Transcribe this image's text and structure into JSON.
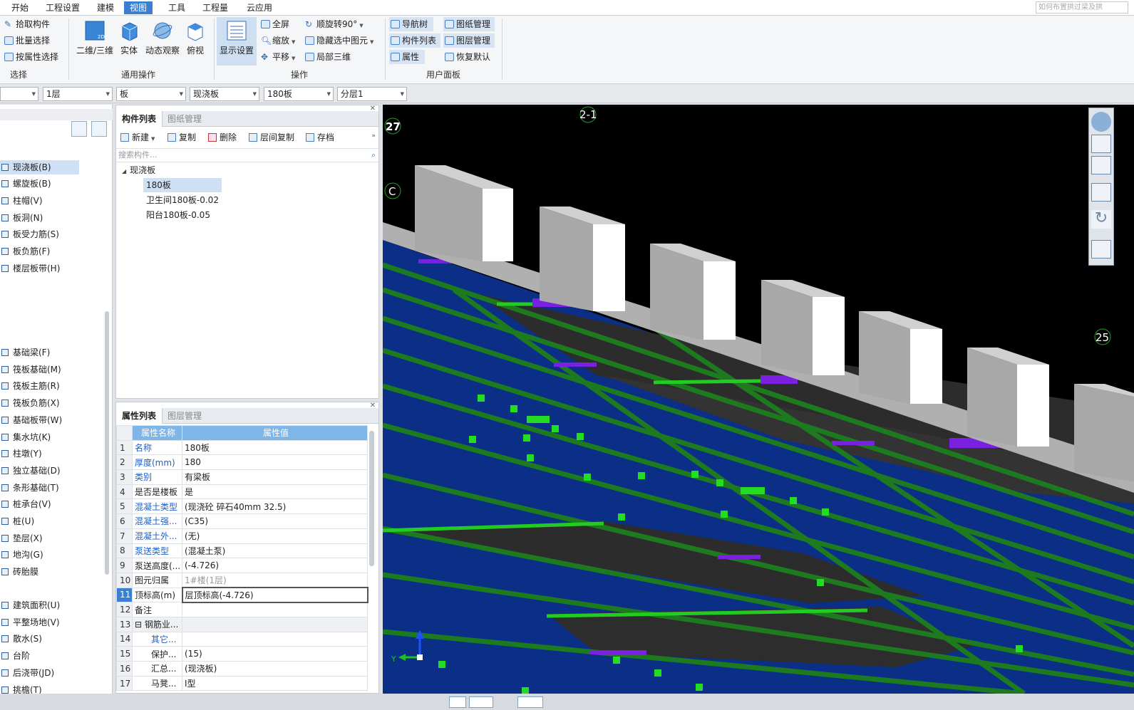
{
  "menubar": {
    "items": [
      "开始",
      "工程设置",
      "建模",
      "视图",
      "工具",
      "工程量",
      "云应用"
    ],
    "active": "视图",
    "search_placeholder": "如何布置拱过梁及拱"
  },
  "ribbon": {
    "select_group": {
      "items": [
        "拾取构件",
        "批量选择",
        "按属性选择"
      ],
      "label": "选择"
    },
    "common_group": {
      "items": [
        "二维/三维",
        "实体",
        "动态观察",
        "俯视"
      ],
      "label": "通用操作"
    },
    "ops_group": {
      "display_settings": "显示设置",
      "col1": [
        "全屏",
        "缩放",
        "平移"
      ],
      "col2": [
        "顺旋转90°",
        "隐藏选中图元",
        "局部三维"
      ],
      "label": "操作"
    },
    "user_group": {
      "col1": [
        "导航树",
        "构件列表",
        "属性"
      ],
      "col2": [
        "图纸管理",
        "图层管理",
        "恢复默认"
      ],
      "label": "用户面板"
    }
  },
  "combos": [
    "",
    "1层",
    "板",
    "现浇板",
    "180板",
    "分层1"
  ],
  "nav": {
    "items": [
      {
        "label": "现浇板(B)",
        "selected": true
      },
      {
        "label": "螺旋板(B)"
      },
      {
        "label": "柱帽(V)"
      },
      {
        "label": "板洞(N)"
      },
      {
        "label": "板受力筋(S)"
      },
      {
        "label": "板负筋(F)"
      },
      {
        "label": "楼层板带(H)"
      }
    ],
    "items2": [
      "基础梁(F)",
      "筏板基础(M)",
      "筏板主筋(R)",
      "筏板负筋(X)",
      "基础板带(W)",
      "集水坑(K)",
      "柱墩(Y)",
      "独立基础(D)",
      "条形基础(T)",
      "桩承台(V)",
      "桩(U)",
      "垫层(X)",
      "地沟(G)",
      "砖胎膜"
    ],
    "items3": [
      "建筑面积(U)",
      "平整场地(V)",
      "散水(S)",
      "台阶",
      "后浇带(JD)",
      "挑檐(T)"
    ]
  },
  "component_panel": {
    "tabs": [
      "构件列表",
      "图纸管理"
    ],
    "toolbar": [
      "新建",
      "复制",
      "删除",
      "层间复制",
      "存档"
    ],
    "search_placeholder": "搜索构件...",
    "tree_root": "现浇板",
    "tree_items": [
      {
        "label": "180板",
        "selected": true
      },
      {
        "label": "卫生间180板-0.02"
      },
      {
        "label": "阳台180板-0.05"
      }
    ]
  },
  "property_panel": {
    "tabs": [
      "属性列表",
      "图层管理"
    ],
    "col_name": "属性名称",
    "col_value": "属性值",
    "rows": [
      {
        "n": "1",
        "name": "名称",
        "value": "180板",
        "link": true
      },
      {
        "n": "2",
        "name": "厚度(mm)",
        "value": "180",
        "link": true
      },
      {
        "n": "3",
        "name": "类别",
        "value": "有梁板",
        "link": true
      },
      {
        "n": "4",
        "name": "是否是楼板",
        "value": "是"
      },
      {
        "n": "5",
        "name": "混凝土类型",
        "value": "(现浇砼 碎石40mm 32.5)",
        "link": true
      },
      {
        "n": "6",
        "name": "混凝土强...",
        "value": "(C35)",
        "link": true
      },
      {
        "n": "7",
        "name": "混凝土外...",
        "value": "(无)",
        "link": true
      },
      {
        "n": "8",
        "name": "泵送类型",
        "value": "(混凝土泵)",
        "link": true
      },
      {
        "n": "9",
        "name": "泵送高度(...",
        "value": "(-4.726)"
      },
      {
        "n": "10",
        "name": "图元归属",
        "value": "1#楼(1层)",
        "grey": true
      },
      {
        "n": "11",
        "name": "顶标高(m)",
        "value": "层顶标高(-4.726)",
        "active": true
      },
      {
        "n": "12",
        "name": "备注",
        "value": ""
      },
      {
        "n": "13",
        "name": "钢筋业...",
        "value": "",
        "group": true
      },
      {
        "n": "14",
        "name": "其它...",
        "value": "",
        "link": true
      },
      {
        "n": "15",
        "name": "保护...",
        "value": "(15)"
      },
      {
        "n": "16",
        "name": "汇总...",
        "value": "(现浇板)"
      },
      {
        "n": "17",
        "name": "马凳...",
        "value": "Ⅰ型"
      }
    ]
  },
  "viewport": {
    "labels": {
      "axis_top": "2-1",
      "left_top": "27",
      "left_mid": "C",
      "right_mid": "25",
      "axis_y": "Y"
    }
  }
}
